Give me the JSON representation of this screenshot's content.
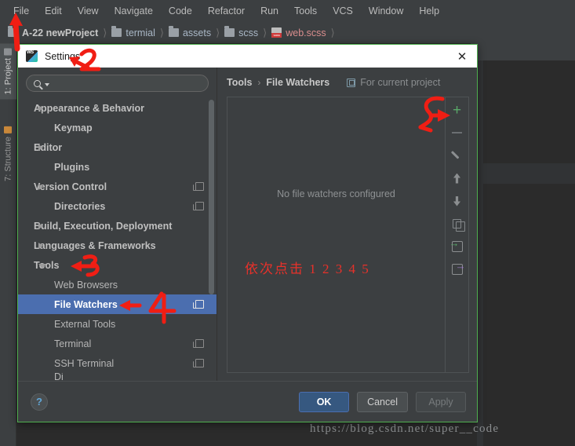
{
  "ide": {
    "menubar": [
      "File",
      "Edit",
      "View",
      "Navigate",
      "Code",
      "Refactor",
      "Run",
      "Tools",
      "VCS",
      "Window",
      "Help"
    ],
    "breadcrumb": [
      {
        "label": "A-22 newProject",
        "icon": "folder-icon"
      },
      {
        "label": "termial",
        "icon": "folder-icon"
      },
      {
        "label": "assets",
        "icon": "folder-icon"
      },
      {
        "label": "scss",
        "icon": "folder-icon"
      },
      {
        "label": "web.scss",
        "icon": "scss-file-icon"
      }
    ],
    "tool_strip": [
      {
        "label": "1: Project",
        "icon": "project-icon"
      },
      {
        "label": "7: Structure",
        "icon": "structure-icon"
      }
    ],
    "watermark": "https://blog.csdn.net/super__code"
  },
  "dialog": {
    "title": "Settings",
    "app_icon": "webstorm-icon",
    "close_icon": "close-icon",
    "search": {
      "placeholder": "",
      "value": "",
      "icon": "search-icon"
    },
    "tree": [
      {
        "label": "Appearance & Behavior",
        "level": 0,
        "arrow": "collapsed",
        "badge": false,
        "selected": false
      },
      {
        "label": "Keymap",
        "level": 0,
        "arrow": "none",
        "badge": false,
        "selected": false
      },
      {
        "label": "Editor",
        "level": 0,
        "arrow": "collapsed",
        "badge": false,
        "selected": false
      },
      {
        "label": "Plugins",
        "level": 0,
        "arrow": "none",
        "badge": false,
        "selected": false
      },
      {
        "label": "Version Control",
        "level": 0,
        "arrow": "collapsed",
        "badge": true,
        "selected": false
      },
      {
        "label": "Directories",
        "level": 0,
        "arrow": "none",
        "badge": true,
        "selected": false
      },
      {
        "label": "Build, Execution, Deployment",
        "level": 0,
        "arrow": "collapsed",
        "badge": false,
        "selected": false
      },
      {
        "label": "Languages & Frameworks",
        "level": 0,
        "arrow": "collapsed",
        "badge": false,
        "selected": false
      },
      {
        "label": "Tools",
        "level": 0,
        "arrow": "expanded",
        "badge": false,
        "selected": false
      },
      {
        "label": "Web Browsers",
        "level": 1,
        "arrow": "none",
        "badge": false,
        "selected": false
      },
      {
        "label": "File Watchers",
        "level": 1,
        "arrow": "none",
        "badge": true,
        "selected": true
      },
      {
        "label": "External Tools",
        "level": 1,
        "arrow": "none",
        "badge": false,
        "selected": false
      },
      {
        "label": "Terminal",
        "level": 1,
        "arrow": "none",
        "badge": true,
        "selected": false
      },
      {
        "label": "SSH Terminal",
        "level": 1,
        "arrow": "none",
        "badge": true,
        "selected": false
      },
      {
        "label": "Di",
        "level": 1,
        "arrow": "none",
        "badge": false,
        "selected": false
      }
    ],
    "pane": {
      "breadcrumb_parent": "Tools",
      "breadcrumb_separator": "›",
      "breadcrumb_current": "File Watchers",
      "scope_label": "For current project",
      "scope_icon": "project-scope-icon",
      "empty_message": "No file watchers configured",
      "annotation_note": "依次点击 1 2  3 4   5",
      "actions": [
        {
          "name": "add",
          "icon": "plus-icon",
          "color": "#59a869"
        },
        {
          "name": "remove",
          "icon": "minus-icon",
          "color": "#6b6f72"
        },
        {
          "name": "edit",
          "icon": "pencil-icon",
          "color": "#8b8e90"
        },
        {
          "name": "move-up",
          "icon": "arrow-up-icon",
          "color": "#8b8e90"
        },
        {
          "name": "move-down",
          "icon": "arrow-down-icon",
          "color": "#8b8e90"
        },
        {
          "name": "copy",
          "icon": "copy-icon",
          "color": "#83878a"
        },
        {
          "name": "import",
          "icon": "import-icon",
          "color": "#59a869"
        },
        {
          "name": "export",
          "icon": "export-icon",
          "color": "#9b7bc4"
        }
      ]
    },
    "footer": {
      "help_label": "?",
      "ok_label": "OK",
      "cancel_label": "Cancel",
      "apply_label": "Apply"
    }
  },
  "annotations": {
    "color": "#f01e14",
    "steps": [
      {
        "num": "1",
        "target": "File menu"
      },
      {
        "num": "2",
        "target": "Settings title"
      },
      {
        "num": "3",
        "target": "Tools tree node"
      },
      {
        "num": "4",
        "target": "File Watchers tree node"
      },
      {
        "num": "5",
        "target": "Add (plus) button"
      }
    ]
  }
}
